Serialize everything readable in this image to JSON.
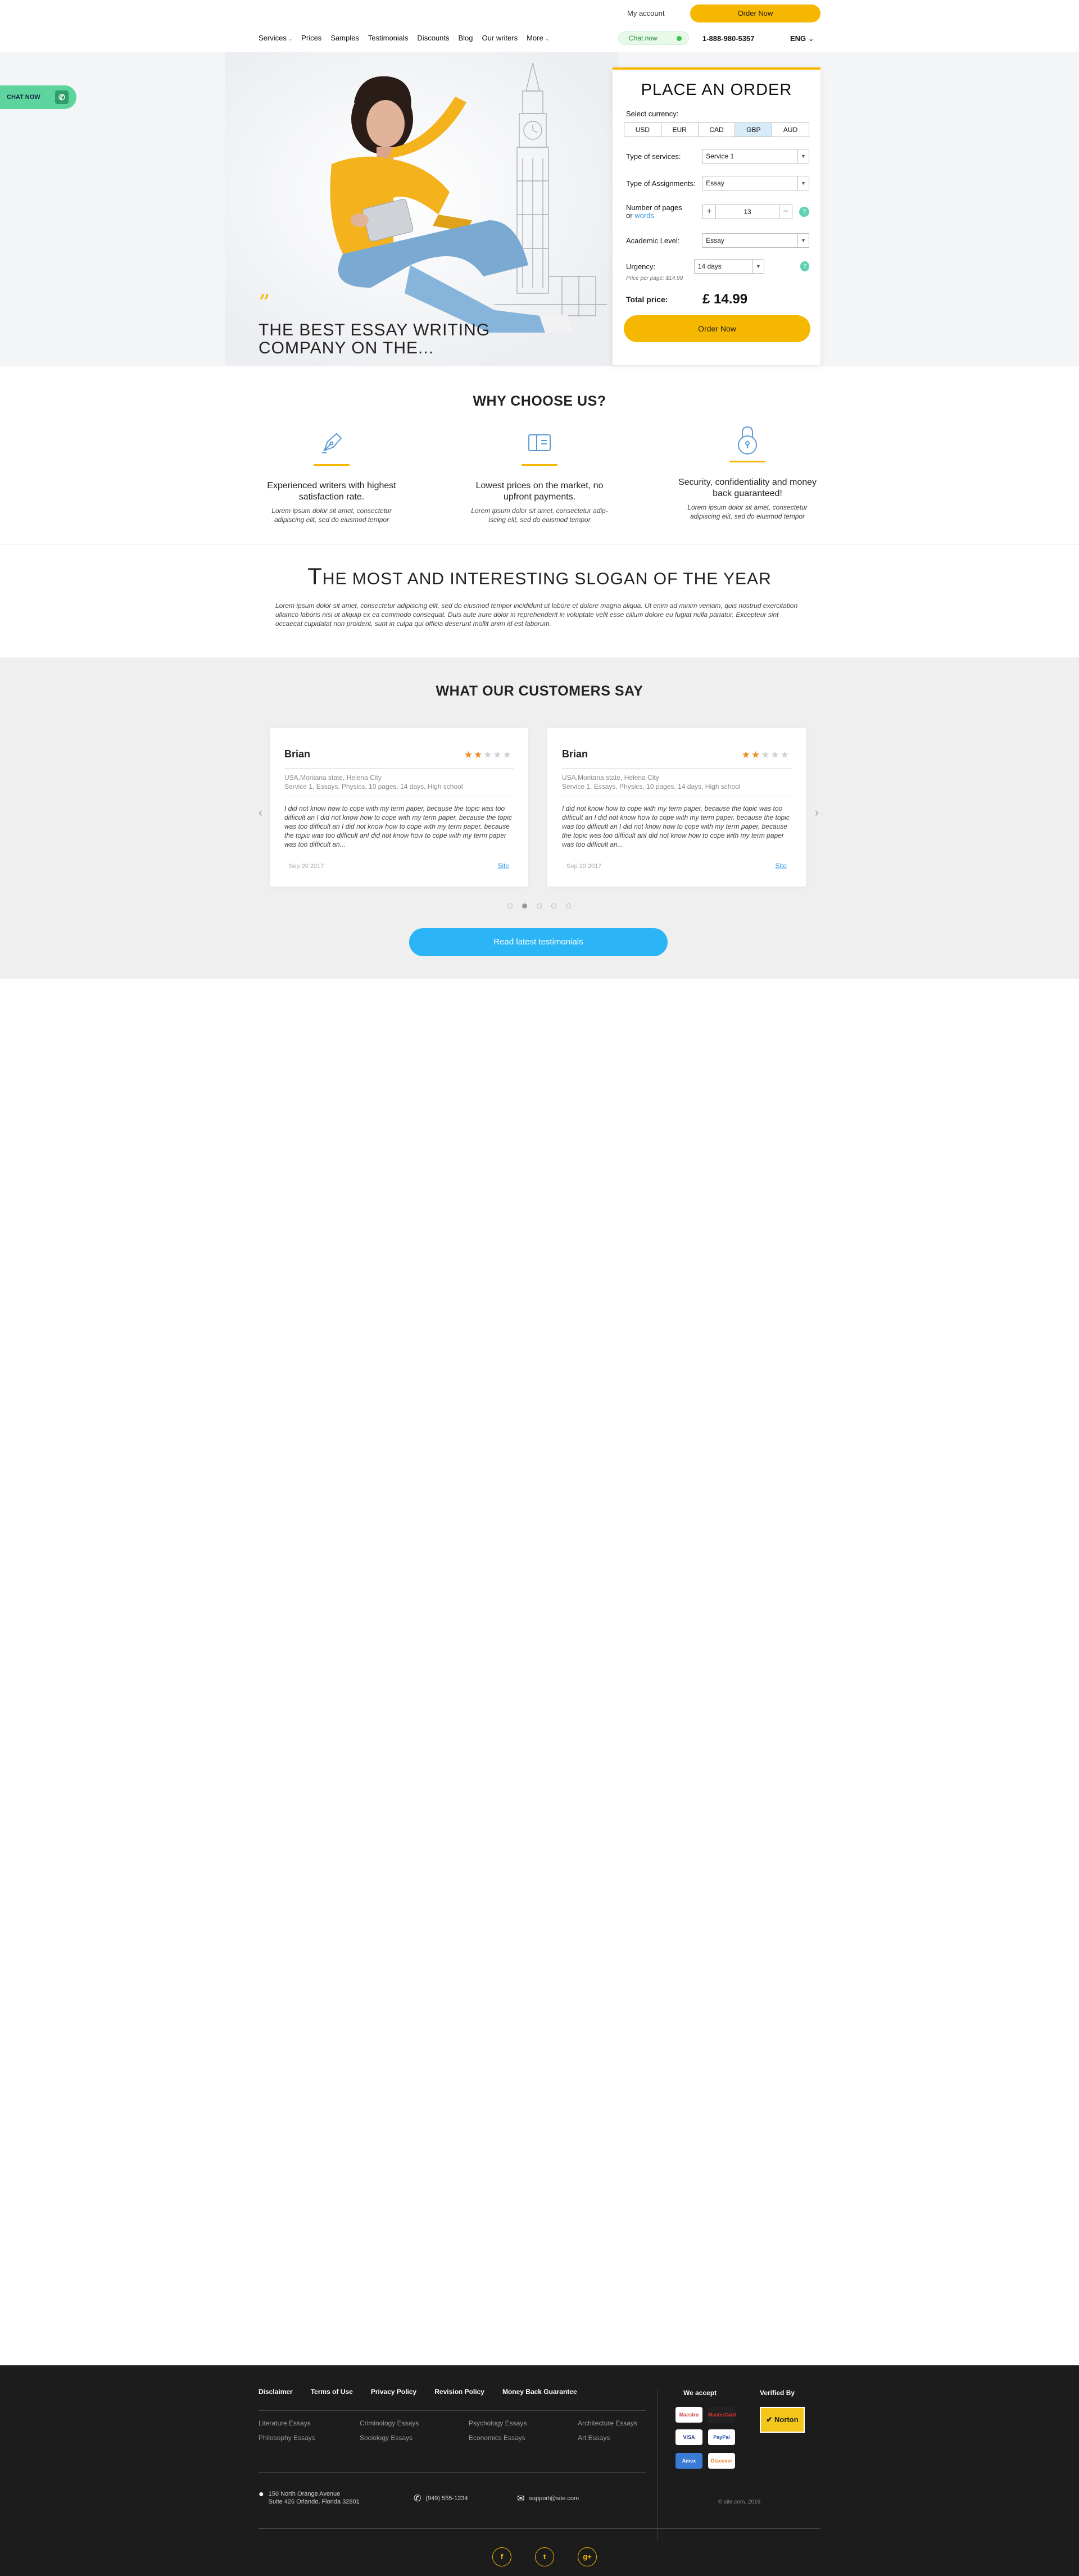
{
  "header": {
    "my_account": "My account",
    "order_now": "Order Now",
    "nav": [
      "Services",
      "Prices",
      "Samples",
      "Testimonials",
      "Discounts",
      "Blog",
      "Our writers",
      "More"
    ],
    "chat_now": "Chat now",
    "phone": "1-888-980-5357",
    "lang": "ENG"
  },
  "side_chat": {
    "label": "CHAT NOW"
  },
  "hero": {
    "quote_mark": "”",
    "title": "The  best essay writing  company on the..."
  },
  "order_form": {
    "title": "PLACE  AN ORDER",
    "currency_label": "Select currency:",
    "currencies": [
      "USD",
      "EUR",
      "CAD",
      "GBP",
      "AUD"
    ],
    "active_currency": "GBP",
    "service_label": "Type of services:",
    "service_value": "Service 1",
    "assignment_label": "Type of Assignments:",
    "assignment_value": "Essay",
    "pages_label": "Number of pages",
    "pages_or": "or",
    "pages_words": "words",
    "pages_value": "13",
    "academic_label": "Academic Level:",
    "academic_value": "Essay",
    "urgency_label": "Urgency:",
    "urgency_value": "14 days",
    "price_per_page": "Price per page: $14.99",
    "total_label": "Total price:",
    "total_value": "£ 14.99",
    "order_button": "Order Now",
    "help": "?"
  },
  "why": {
    "title": "WHY CHOOSE US?",
    "features": [
      {
        "icon": "pen-nib-icon",
        "title": "Experienced writers with highest satisfaction rate.",
        "text": "Lorem ipsum dolor sit amet, consectetur adipiscing elit, sed do eiusmod tempor"
      },
      {
        "icon": "wallet-icon",
        "title": "Lowest prices on the market, no upfront payments.",
        "text": "Lorem ipsum dolor sit amet, consectetur adip-iscing elit, sed do eiusmod tempor"
      },
      {
        "icon": "padlock-icon",
        "title": "Security, confidentiality and money back guaranteed!",
        "text": "Lorem ipsum dolor sit amet, consectetur adipiscing elit, sed do eiusmod tempor"
      }
    ]
  },
  "slogan": {
    "title_first": "T",
    "title_rest": "HE MOST AND INTERESTING SLOGAN OF THE YEAR",
    "text": "Lorem ipsum dolor sit amet, consectetur adipiscing elit, sed do eiusmod tempor incididunt ut labore et dolore magna aliqua. Ut enim ad minim veniam, quis nostrud exercitation ullamco laboris nisi ut aliquip ex ea commodo consequat. Duis aute irure dolor in reprehenderit in voluptate velit esse cillum dolore eu fugiat nulla pariatur. Excepteur sint occaecat cupidatat non proident, sunt in culpa qui officia deserunt mollit anim id est laborum."
  },
  "testimonials": {
    "title": "WHAT OUR CUSTOMERS SAY",
    "cards": [
      {
        "name": "Brian",
        "rating": 2,
        "location": "USA,Montana state, Helena City",
        "details": "Service 1, Essays, Physics, 10 pages, 14 days, High school",
        "body": "I did not know how to cope with my term paper, because the topic was too difficult an I did not know how to cope with my term paper, because the topic was too difficult an I did not know how to cope with my term paper, because the topic was too difficult anI did not know how to cope with my term paper was too difficult an...",
        "date": "Sep 20 2017",
        "site": "Site"
      },
      {
        "name": "Brian",
        "rating": 2,
        "location": "USA,Montana state, Helena City",
        "details": "Service 1, Essays, Physics, 10 pages, 14 days, High school",
        "body": "I did not know how to cope with my term paper, because the topic was too difficult an I did not know how to cope with my term paper, because the topic was too difficult an I did not know how to cope with my term paper, because the topic was too difficult anI did not know how to cope with my term paper was too difficult an...",
        "date": "Sep 20 2017",
        "site": "Site"
      }
    ],
    "dots_count": 5,
    "active_dot": 1,
    "read_button": "Read latest testimonials"
  },
  "footer": {
    "links": [
      "Disclaimer",
      "Terms of Use",
      "Privacy Policy",
      "Revision Policy",
      "Money Back Guarantee"
    ],
    "essays": [
      "Literature Essays",
      "Criminology Essays",
      "Psychology Essays",
      "Architecture Essays",
      "Philosophy Essays",
      "Sociology Essays",
      "Economics Essays",
      "Art Essays"
    ],
    "address_line1": "150 North Orange Avenue",
    "address_line2": "Suite 426 Orlando, Florida 32801",
    "phone": "(949) 555-1234",
    "email": "support@site.com",
    "we_accept": "We accept",
    "verified_by": "Verified By",
    "payment_cards": [
      "Maestro",
      "MasterCard",
      "VISA",
      "PayPal",
      "Amex",
      "Discover"
    ],
    "norton": "Norton",
    "copyright": "© site.com, 2016",
    "socials": [
      "f",
      "t",
      "g+"
    ]
  }
}
